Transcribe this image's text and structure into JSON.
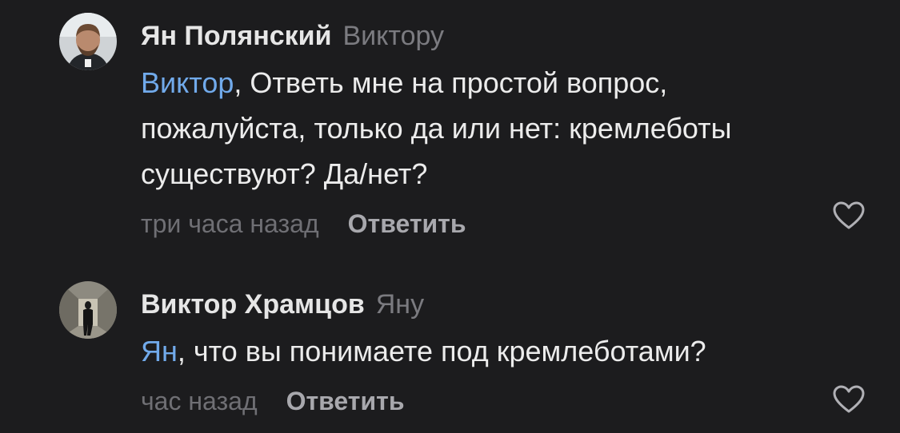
{
  "comments": [
    {
      "author": "Ян Полянский",
      "reply_to": "Виктору",
      "mention": "Виктор",
      "text_line_1": ", Ответь мне на простой вопрос,",
      "text_line_2": "пожалуйста, только да или нет: кремлеботы",
      "text_line_3": "существуют? Да/нет?",
      "time": "три часа назад",
      "reply_label": "Ответить",
      "avatar_icon": "user-photo-man-beard",
      "like_icon": "heart-outline-icon"
    },
    {
      "author": "Виктор Храмцов",
      "reply_to": "Яну",
      "mention": "Ян",
      "text_line_1": ", что вы понимаете под кремлеботами?",
      "time": "час назад",
      "reply_label": "Ответить",
      "avatar_icon": "user-photo-silhouette-corridor",
      "like_icon": "heart-outline-icon"
    }
  ],
  "colors": {
    "background": "#1c1c1e",
    "mention": "#71aaeb",
    "secondary": "#6f6f74",
    "reply_button": "#a8a8ad"
  }
}
